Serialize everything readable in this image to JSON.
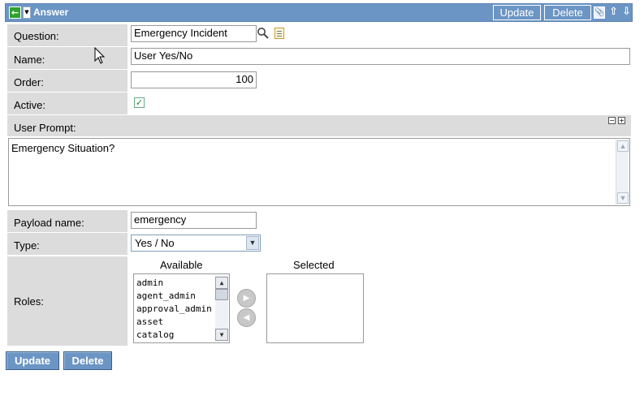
{
  "header": {
    "title": "Answer",
    "update_label": "Update",
    "delete_label": "Delete",
    "bg_color": "#6b95c5"
  },
  "form": {
    "question": {
      "label": "Question:",
      "value": "Emergency Incident"
    },
    "name": {
      "label": "Name:",
      "value": "User Yes/No"
    },
    "order": {
      "label": "Order:",
      "value": "100"
    },
    "active": {
      "label": "Active:",
      "checked": true
    },
    "user_prompt": {
      "label": "User Prompt:",
      "value": "Emergency Situation?"
    },
    "payload_name": {
      "label": "Payload name:",
      "value": "emergency"
    },
    "type": {
      "label": "Type:",
      "selected": "Yes / No"
    },
    "roles": {
      "label": "Roles:",
      "available_heading": "Available",
      "selected_heading": "Selected",
      "available": [
        "admin",
        "agent_admin",
        "approval_admin",
        "asset",
        "catalog"
      ],
      "selected": []
    }
  },
  "footer": {
    "update_label": "Update",
    "delete_label": "Delete"
  }
}
